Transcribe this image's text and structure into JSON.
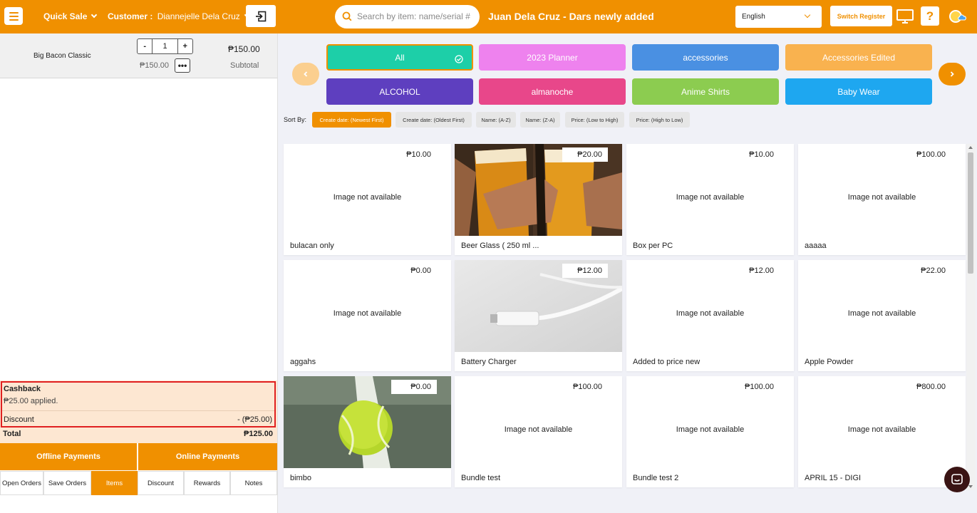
{
  "topbar": {
    "menu_icon": "hamburger-icon",
    "quick_sale": "Quick Sale",
    "customer_label": "Customer :",
    "customer_name": "Diannejelle Dela Cruz",
    "search_placeholder": "Search by item: name/serial #",
    "store_title": "Juan Dela Cruz - Dars newly added",
    "language": "English",
    "switch_register": "Switch Register",
    "help": "?"
  },
  "cart": {
    "items": [
      {
        "name": "Big Bacon Classic",
        "qty": "1",
        "unit_price": "₱150.00",
        "price": "₱150.00",
        "subtotal_label": "Subtotal"
      }
    ],
    "minus": "-",
    "plus": "+"
  },
  "summary": {
    "cashback_title": "Cashback",
    "cashback_applied": "₱25.00 applied.",
    "discount_label": "Discount",
    "discount_value": "- (₱25.00)",
    "total_label": "Total",
    "total_value": "₱125.00"
  },
  "payments": {
    "offline": "Offline Payments",
    "online": "Online Payments"
  },
  "bottom_tabs": [
    "Open Orders",
    "Save Orders",
    "Items",
    "Discount",
    "Rewards",
    "Notes"
  ],
  "categories": [
    {
      "label": "All",
      "color": "#1dcfa8"
    },
    {
      "label": "2023 Planner",
      "color": "#ee82ee"
    },
    {
      "label": "accessories",
      "color": "#4a90e2"
    },
    {
      "label": "Accessories Edited",
      "color": "#f9b24f"
    },
    {
      "label": "ALCOHOL",
      "color": "#5e3fbf"
    },
    {
      "label": "almanoche",
      "color": "#e8478a"
    },
    {
      "label": "Anime Shirts",
      "color": "#8ccc50"
    },
    {
      "label": "Baby Wear",
      "color": "#1ea7f0"
    }
  ],
  "sort": {
    "label": "Sort By:",
    "options": [
      "Create date: (Newest First)",
      "Create date: (Oldest First)",
      "Name: (A-Z)",
      "Name: (Z-A)",
      "Price: (Low to High)",
      "Price: (High to Low)"
    ]
  },
  "no_image_text": "Image not available",
  "products": [
    {
      "name": "bulacan only",
      "price": "₱10.00",
      "image": "none"
    },
    {
      "name": "Beer Glass ( 250 ml ...",
      "price": "₱20.00",
      "image": "beer"
    },
    {
      "name": "Box per PC",
      "price": "₱10.00",
      "image": "none"
    },
    {
      "name": "aaaaa",
      "price": "₱100.00",
      "image": "none"
    },
    {
      "name": "aggahs",
      "price": "₱0.00",
      "image": "none"
    },
    {
      "name": "Battery Charger",
      "price": "₱12.00",
      "image": "cable"
    },
    {
      "name": "Added to price new",
      "price": "₱12.00",
      "image": "none"
    },
    {
      "name": "Apple Powder",
      "price": "₱22.00",
      "image": "none"
    },
    {
      "name": "bimbo",
      "price": "₱0.00",
      "image": "ball"
    },
    {
      "name": "Bundle test",
      "price": "₱100.00",
      "image": "none"
    },
    {
      "name": "Bundle test 2",
      "price": "₱100.00",
      "image": "none"
    },
    {
      "name": "APRIL 15 - DIGI",
      "price": "₱800.00",
      "image": "none"
    }
  ],
  "colors": {
    "accent": "#f09000",
    "summary_bg": "#fde7d2",
    "highlight_border": "#e02020"
  }
}
